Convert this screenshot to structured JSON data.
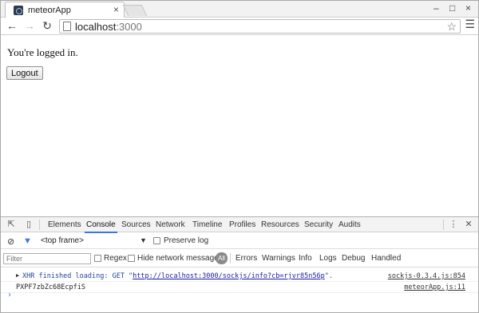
{
  "browser": {
    "tab_title": "meteorApp",
    "tab_close": "×",
    "window_controls": {
      "minimize": "–",
      "maximize": "□",
      "close": "×"
    },
    "url_host": "localhost",
    "url_port": ":3000",
    "icons": {
      "back": "arrow-left",
      "forward": "arrow-right",
      "reload": "reload",
      "page": "document",
      "bookmark": "star",
      "menu": "hamburger"
    }
  },
  "page": {
    "message": "You're logged in.",
    "logout_label": "Logout"
  },
  "devtools": {
    "tabs": [
      "Elements",
      "Console",
      "Sources",
      "Network",
      "Timeline",
      "Profiles",
      "Resources",
      "Security",
      "Audits"
    ],
    "active_tab": "Console",
    "frame_select": "<top frame>",
    "preserve_log": "Preserve log",
    "filter_placeholder": "Filter",
    "regex": "Regex",
    "hide_network": "Hide network messages",
    "levels": [
      "All",
      "Errors",
      "Warnings",
      "Info",
      "Logs",
      "Debug",
      "Handled"
    ],
    "logs": [
      {
        "prefix": "XHR finished loading: GET \"",
        "url": "http://localhost:3000/sockjs/info?cb=rjvr85n56p",
        "suffix": "\".",
        "source": "sockjs-0.3.4.js:854"
      },
      {
        "text": "PXPF7zbZc68EcpfiS",
        "source": "meteorApp.js:11"
      }
    ],
    "prompt": "›"
  },
  "colors": {
    "accent": "#3879d9",
    "link": "#1a1aa6"
  }
}
